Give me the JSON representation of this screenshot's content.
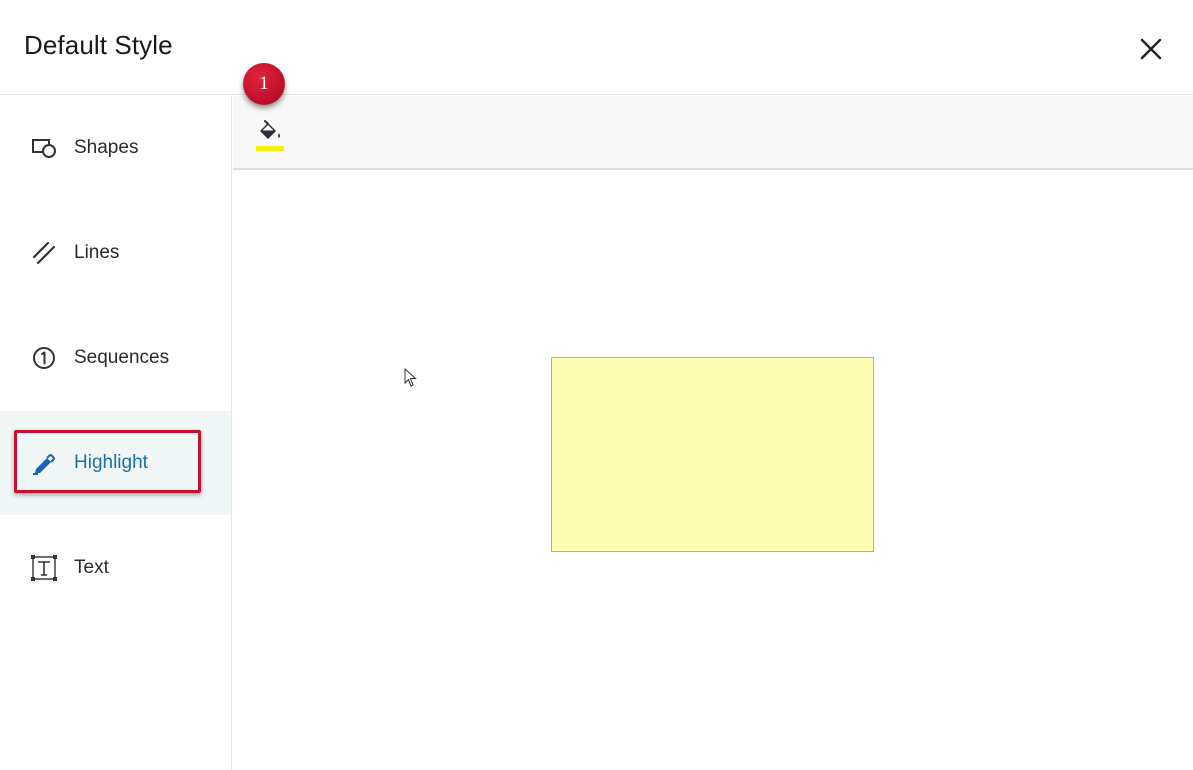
{
  "header": {
    "title": "Default Style",
    "close_icon": "close-icon"
  },
  "sidebar": {
    "items": [
      {
        "label": "Shapes",
        "icon": "shapes-icon",
        "active": false
      },
      {
        "label": "Lines",
        "icon": "lines-icon",
        "active": false
      },
      {
        "label": "Sequences",
        "icon": "sequence-number-icon",
        "active": false
      },
      {
        "label": "Highlight",
        "icon": "highlighter-pen-icon",
        "active": true
      },
      {
        "label": "Text",
        "icon": "text-box-icon",
        "active": false
      }
    ]
  },
  "toolbar": {
    "fill_tool_icon": "paint-bucket-icon",
    "fill_color": "#f5f20a"
  },
  "annotation": {
    "badge_number": "1",
    "badge_color": "#c8102e"
  },
  "preview": {
    "fill_color": "#fdfeb2",
    "border_color": "#8fb6c9"
  },
  "colors": {
    "active_item_text": "#1a6fa8",
    "active_item_bg": "#f1f7f7",
    "icon_active": "#1565c0"
  }
}
